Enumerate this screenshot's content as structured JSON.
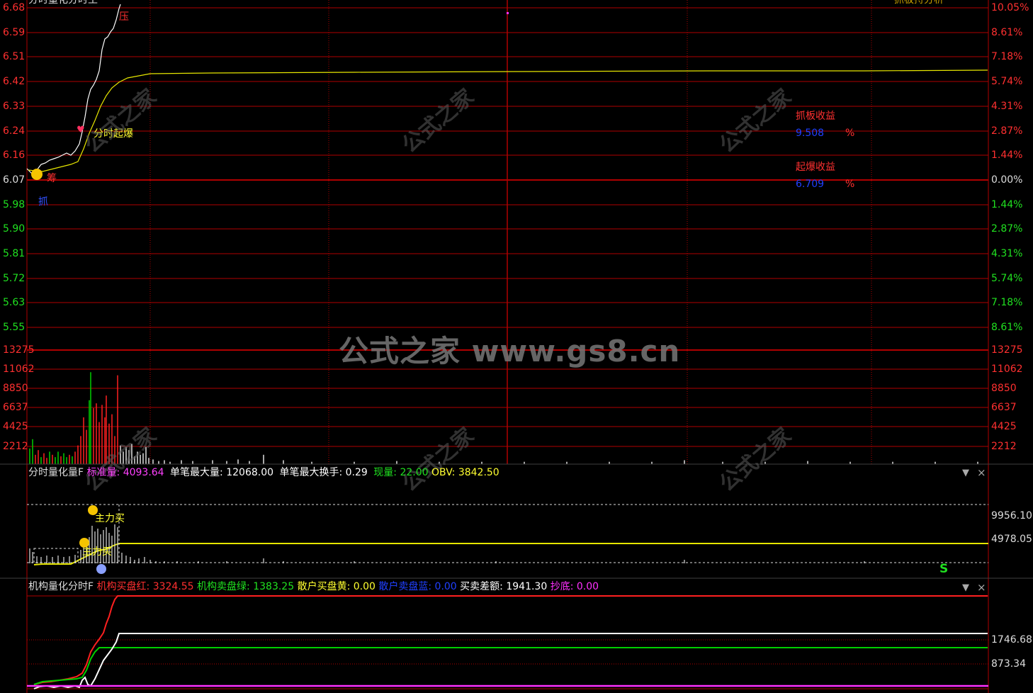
{
  "top_bar": {
    "left_text": "分时量化分时主",
    "right_link": "抓板持分析"
  },
  "price_axis_left": [
    "6.68",
    "6.59",
    "6.51",
    "6.42",
    "6.33",
    "6.24",
    "6.16",
    "6.07",
    "5.98",
    "5.90",
    "5.81",
    "5.72",
    "5.63",
    "5.55"
  ],
  "price_axis_right": [
    "10.05%",
    "8.61%",
    "7.18%",
    "5.74%",
    "4.31%",
    "2.87%",
    "1.44%",
    "0.00%",
    "1.44%",
    "2.87%",
    "4.31%",
    "5.74%",
    "7.18%",
    "8.61%"
  ],
  "vol_axis_left": [
    "13275",
    "11062",
    "8850",
    "6637",
    "4425",
    "2212"
  ],
  "vol_axis_right": [
    "13275",
    "11062",
    "8850",
    "6637",
    "4425",
    "2212"
  ],
  "signals": {
    "pressure": "压",
    "burst": "分时起爆",
    "chip": "筹",
    "grab": "抓"
  },
  "stats": {
    "limit_title": "抓板收益",
    "limit_value": "9.508",
    "burst_title": "起爆收益",
    "burst_value": "6.709",
    "pct": "%"
  },
  "watermark": {
    "main": "公式之家 www.gs8.cn",
    "small": "公式之家",
    "small_url": "www.gs8.cn"
  },
  "panel2": {
    "title": "分时量化量F",
    "std_label": "标准量",
    "std_value": "4093.64",
    "max_vol_label": "单笔最大量",
    "max_vol_value": "12068.00",
    "max_turn_label": "单笔最大换手",
    "max_turn_value": "0.29",
    "cur_label": "现量",
    "cur_value": "22.00",
    "obv_label": "OBV",
    "obv_value": "3842.50",
    "axis": [
      "9956.10",
      "4978.05"
    ],
    "main_buy": "主力买",
    "main_buy2": "主力买",
    "s_mark": "S"
  },
  "panel3": {
    "title": "机构量化分时F",
    "inst_buy_label": "机构买盘红",
    "inst_buy_value": "3324.55",
    "inst_sell_label": "机构卖盘绿",
    "inst_sell_value": "1383.25",
    "retail_buy_label": "散户买盘黄",
    "retail_buy_value": "0.00",
    "retail_sell_label": "散户卖盘蓝",
    "retail_sell_value": "0.00",
    "diff_label": "买卖差额",
    "diff_value": "1941.30",
    "bottom_label": "抄底",
    "bottom_value": "0.00",
    "axis": [
      "1746.68",
      "873.34"
    ]
  },
  "controls": {
    "dropdown": "▼",
    "close": "×"
  },
  "colors": {
    "grid": "#b00000",
    "price_line": "#ffffff",
    "avg_line": "#e6e600",
    "up": "#ff2020",
    "down": "#00d000",
    "magenta": "#ff30ff"
  }
}
